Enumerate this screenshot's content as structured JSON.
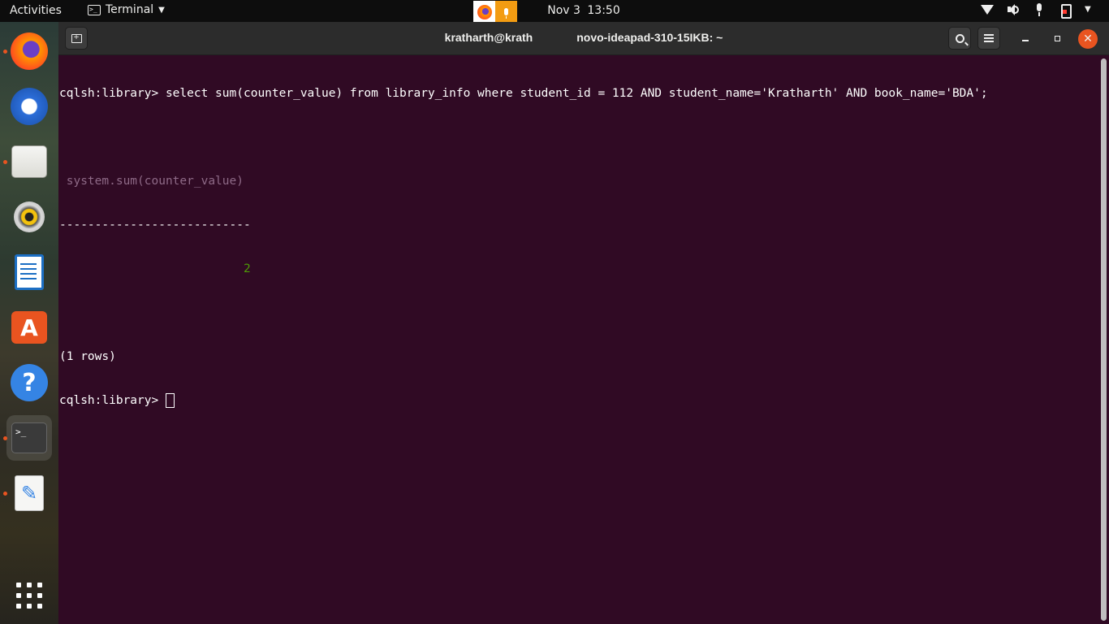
{
  "topbar": {
    "activities": "Activities",
    "app_name": "Terminal",
    "date": "Nov 3",
    "time": "13:50"
  },
  "dock": {
    "items": [
      {
        "name": "firefox",
        "running": true
      },
      {
        "name": "thunderbird",
        "running": false
      },
      {
        "name": "files",
        "running": true
      },
      {
        "name": "rhythmbox",
        "running": false
      },
      {
        "name": "libreoffice-writer",
        "running": false
      },
      {
        "name": "ubuntu-software",
        "running": false
      },
      {
        "name": "help",
        "running": false
      },
      {
        "name": "terminal",
        "running": true,
        "active": true
      },
      {
        "name": "text-editor",
        "running": true
      }
    ]
  },
  "window": {
    "title_left": "kratharth@krath",
    "title_right": "novo-ideapad-310-15IKB: ~"
  },
  "terminal": {
    "prompt": "cqlsh:library> ",
    "command": "select sum(counter_value) from library_info where student_id = 112 AND student_name='Kratharth' AND book_name='BDA';",
    "result_header": " system.sum(counter_value)",
    "result_separator": "---------------------------",
    "result_value": "                          2",
    "row_count": "(1 rows)"
  },
  "colors": {
    "terminal_bg": "#300a24",
    "header_dim": "#8e6a87",
    "value_green": "#4e9a06",
    "close_orange": "#e95420"
  }
}
